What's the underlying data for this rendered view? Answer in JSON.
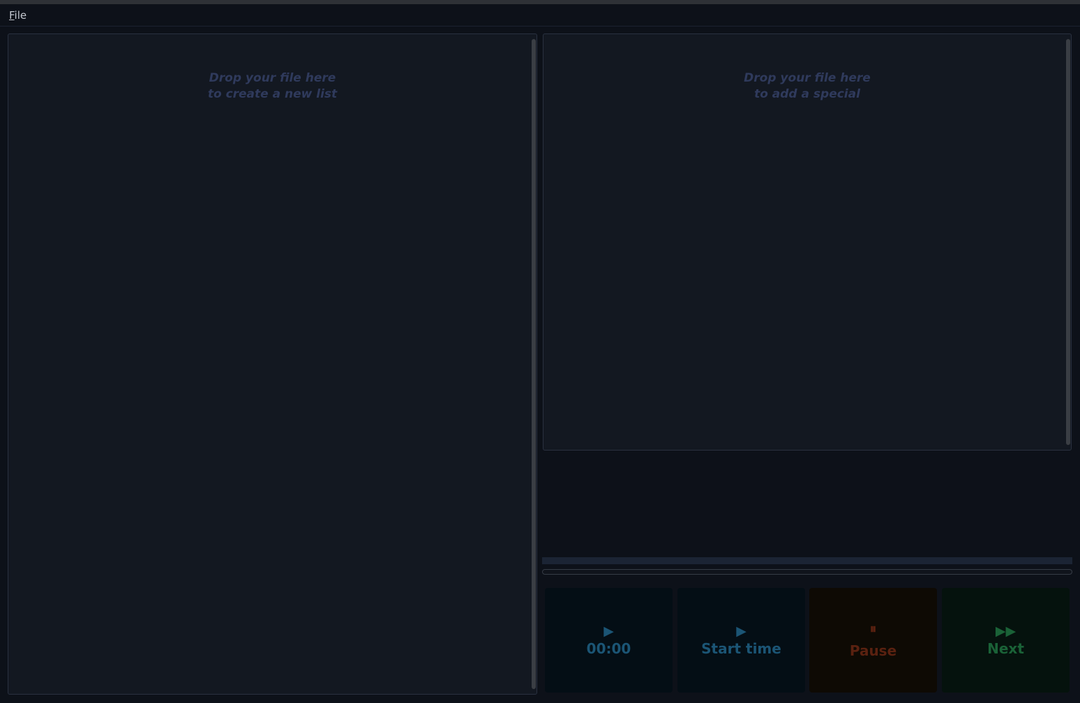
{
  "menu": {
    "file_mnemonic": "F",
    "file_rest": "ile"
  },
  "left_panel": {
    "hint_line1": "Drop your file here",
    "hint_line2": "to create a new list"
  },
  "right_panel": {
    "hint_line1": "Drop your file here",
    "hint_line2": "to add a special"
  },
  "controls": {
    "time": {
      "icon": "▶",
      "label": "00:00",
      "icon_name": "play-icon"
    },
    "start": {
      "icon": "▶",
      "label": "Start time",
      "icon_name": "play-icon"
    },
    "pause": {
      "icon": "⏸",
      "label": "Pause",
      "icon_name": "pause-icon"
    },
    "next": {
      "icon": "▶▶",
      "label": "Next",
      "icon_name": "fast-forward-icon"
    }
  },
  "colors": {
    "background": "#0d1119",
    "panel": "#131821",
    "hint_text": "#2f3a5c",
    "blue_text": "#1b5575",
    "orange_text": "#5a2110",
    "green_text": "#1a6237"
  }
}
